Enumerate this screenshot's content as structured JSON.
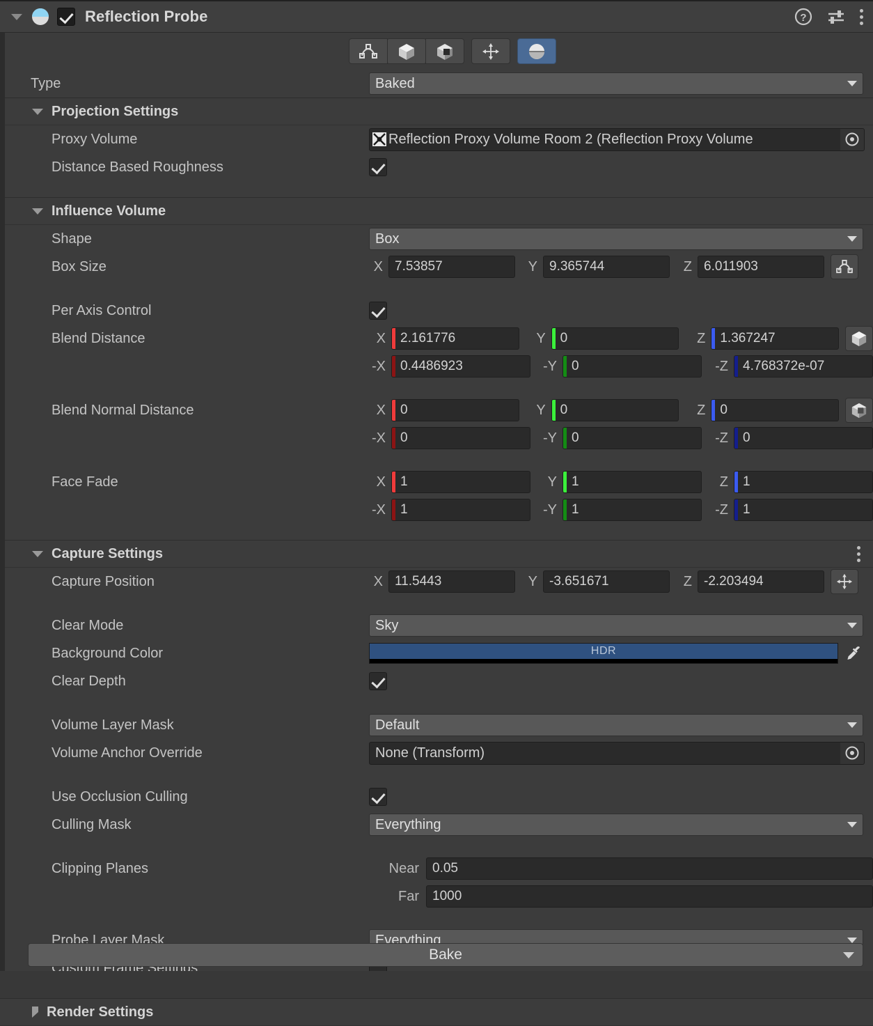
{
  "header": {
    "title": "Reflection Probe",
    "enabled_checkbox": true,
    "icon": "reflection-probe-icon",
    "help_icon": "help-icon",
    "preset_icon": "preset-settings-icon",
    "menu_icon": "kebab-menu-icon"
  },
  "toolbar": {
    "buttons": [
      {
        "name": "influence-volume-tool",
        "icon": "curve-nodes-icon",
        "active": false
      },
      {
        "name": "box-volume-tool",
        "icon": "box-icon",
        "active": false
      },
      {
        "name": "blend-volume-tool",
        "icon": "box-cutout-icon",
        "active": false
      },
      {
        "name": "move-tool",
        "icon": "move-arrows-icon",
        "active": false
      },
      {
        "name": "probe-tool",
        "icon": "sphere-icon",
        "active": true
      }
    ]
  },
  "type_row": {
    "label": "Type",
    "value": "Baked"
  },
  "projection_settings": {
    "title": "Projection Settings",
    "expanded": true,
    "proxy_volume": {
      "label": "Proxy Volume",
      "value": "Reflection Proxy Volume Room 2 (Reflection Proxy Volume",
      "icon": "proxy-volume-icon",
      "picker_icon": "object-picker-icon"
    },
    "distance_based_roughness": {
      "label": "Distance Based Roughness",
      "checked": true
    }
  },
  "influence_volume": {
    "title": "Influence Volume",
    "expanded": true,
    "shape": {
      "label": "Shape",
      "value": "Box"
    },
    "box_size": {
      "label": "Box Size",
      "axes": [
        "X",
        "Y",
        "Z"
      ],
      "values": [
        "7.53857",
        "9.365744",
        "6.011903"
      ],
      "button_icon": "curve-nodes-icon"
    },
    "per_axis_control": {
      "label": "Per Axis Control",
      "checked": true
    },
    "blend_distance": {
      "label": "Blend Distance",
      "pos_axes": [
        "X",
        "Y",
        "Z"
      ],
      "pos_values": [
        "2.161776",
        "0",
        "1.367247"
      ],
      "neg_axes": [
        "-X",
        "-Y",
        "-Z"
      ],
      "neg_values": [
        "0.4486923",
        "0",
        "4.768372e-07"
      ],
      "button_icon": "box-icon"
    },
    "blend_normal_distance": {
      "label": "Blend Normal Distance",
      "pos_axes": [
        "X",
        "Y",
        "Z"
      ],
      "pos_values": [
        "0",
        "0",
        "0"
      ],
      "neg_axes": [
        "-X",
        "-Y",
        "-Z"
      ],
      "neg_values": [
        "0",
        "0",
        "0"
      ],
      "button_icon": "box-cutout-icon"
    },
    "face_fade": {
      "label": "Face Fade",
      "pos_axes": [
        "X",
        "Y",
        "Z"
      ],
      "pos_values": [
        "1",
        "1",
        "1"
      ],
      "neg_axes": [
        "-X",
        "-Y",
        "-Z"
      ],
      "neg_values": [
        "1",
        "1",
        "1"
      ]
    }
  },
  "capture_settings": {
    "title": "Capture Settings",
    "expanded": true,
    "menu_icon": "kebab-menu-icon",
    "capture_position": {
      "label": "Capture Position",
      "axes": [
        "X",
        "Y",
        "Z"
      ],
      "values": [
        "11.5443",
        "-3.651671",
        "-2.203494"
      ],
      "button_icon": "move-arrows-icon"
    },
    "clear_mode": {
      "label": "Clear Mode",
      "value": "Sky"
    },
    "background_color": {
      "label": "Background Color",
      "hdr_label": "HDR",
      "swatch": "#2f5180",
      "alpha": "#000000",
      "eyedropper_icon": "eyedropper-icon"
    },
    "clear_depth": {
      "label": "Clear Depth",
      "checked": true
    },
    "volume_layer_mask": {
      "label": "Volume Layer Mask",
      "value": "Default"
    },
    "volume_anchor_override": {
      "label": "Volume Anchor Override",
      "value": "None (Transform)",
      "picker_icon": "object-picker-icon"
    },
    "use_occlusion_culling": {
      "label": "Use Occlusion Culling",
      "checked": true
    },
    "culling_mask": {
      "label": "Culling Mask",
      "value": "Everything"
    },
    "clipping_planes": {
      "label": "Clipping Planes",
      "near_label": "Near",
      "near_value": "0.05",
      "far_label": "Far",
      "far_value": "1000"
    },
    "probe_layer_mask": {
      "label": "Probe Layer Mask",
      "value": "Everything"
    },
    "custom_frame_settings": {
      "label": "Custom Frame Settings",
      "checked": false
    }
  },
  "render_settings": {
    "title": "Render Settings",
    "expanded": false
  },
  "bake": {
    "label": "Bake",
    "dropdown_icon": "chevron-down-icon"
  },
  "axis_colors": {
    "x": "#f03b3b",
    "y": "#3bf03b",
    "z": "#3b5bf0",
    "x_dim": "#8c1414",
    "y_dim": "#148c14",
    "z_dim": "#141e8c"
  }
}
